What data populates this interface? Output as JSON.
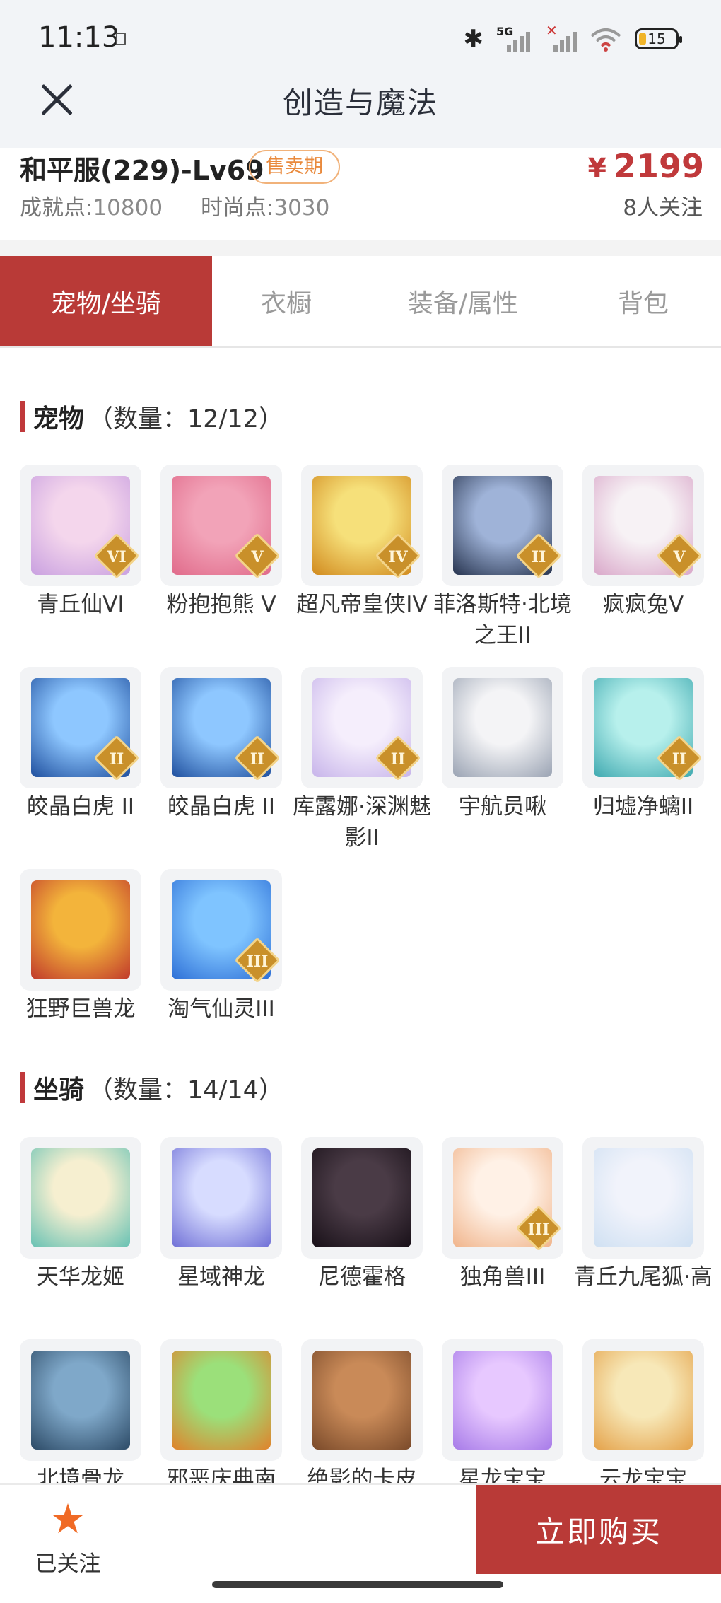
{
  "status_bar": {
    "time": "11:13",
    "sim1_label": "5G",
    "battery_level": "15"
  },
  "header": {
    "title": "创造与魔法"
  },
  "account": {
    "server": "和平服(229)-Lv69",
    "badge": "售卖期",
    "price_currency": "¥",
    "price_value": "2199",
    "achievement_label": "成就点:",
    "achievement_value": "10800",
    "fashion_label": "时尚点:",
    "fashion_value": "3030",
    "followers": "8人关注"
  },
  "tabs": [
    {
      "label": "宠物/坐骑",
      "active": true
    },
    {
      "label": "衣橱",
      "active": false
    },
    {
      "label": "装备/属性",
      "active": false
    },
    {
      "label": "背包",
      "active": false
    }
  ],
  "pets_section": {
    "title": "宠物",
    "count": "（数量：12/12）",
    "items": [
      {
        "name": "青丘仙VI",
        "rank": "VI",
        "icon": "fox-fairy-pet"
      },
      {
        "name": "粉抱抱熊 V",
        "rank": "V",
        "icon": "pink-bear-pet"
      },
      {
        "name": "超凡帝皇侠IV",
        "rank": "IV",
        "icon": "golden-knight-pet"
      },
      {
        "name": "菲洛斯特·北境之王II",
        "rank": "II",
        "icon": "frost-king-pet"
      },
      {
        "name": "疯疯兔V",
        "rank": "V",
        "icon": "crazy-rabbit-pet"
      },
      {
        "name": "皎晶白虎 II",
        "rank": "II",
        "icon": "white-tiger-pet"
      },
      {
        "name": "皎晶白虎 II",
        "rank": "II",
        "icon": "white-tiger-pet"
      },
      {
        "name": "库露娜·深渊魅影II",
        "rank": "II",
        "icon": "abyss-girl-pet"
      },
      {
        "name": "宇航员啾",
        "rank": "",
        "icon": "astronaut-pet"
      },
      {
        "name": "归墟净螭II",
        "rank": "II",
        "icon": "jade-dragon-pet"
      },
      {
        "name": "狂野巨兽龙",
        "rank": "",
        "icon": "wild-beast-dragon-pet"
      },
      {
        "name": "淘气仙灵III",
        "rank": "III",
        "icon": "naughty-spirit-pet"
      }
    ]
  },
  "mounts_section": {
    "title": "坐骑",
    "count": "（数量：14/14）",
    "items": [
      {
        "name": "天华龙姬",
        "rank": "",
        "icon": "dragon-princess-mount"
      },
      {
        "name": "星域神龙",
        "rank": "",
        "icon": "star-dragon-mount"
      },
      {
        "name": "尼德霍格",
        "rank": "",
        "icon": "nidhogg-mount"
      },
      {
        "name": "独角兽III",
        "rank": "III",
        "icon": "unicorn-mount"
      },
      {
        "name": "青丘九尾狐·高",
        "rank": "",
        "icon": "nine-tail-fox-mount"
      },
      {
        "name": "北境骨龙",
        "rank": "",
        "icon": "bone-dragon-mount"
      },
      {
        "name": "邪恶庆典南",
        "rank": "",
        "icon": "pumpkin-frog-mount"
      },
      {
        "name": "绝影的卡皮",
        "rank": "",
        "icon": "capybara-mount"
      },
      {
        "name": "星龙宝宝",
        "rank": "",
        "icon": "baby-star-dragon-mount"
      },
      {
        "name": "云龙宝宝",
        "rank": "",
        "icon": "baby-cloud-dragon-mount"
      }
    ]
  },
  "bottom_bar": {
    "follow_label": "已关注",
    "buy_label": "立即购买"
  },
  "colors": {
    "accent": "#b93a37",
    "price": "#c0393b",
    "badge": "#e98a3d",
    "follow_star": "#f06a25"
  }
}
